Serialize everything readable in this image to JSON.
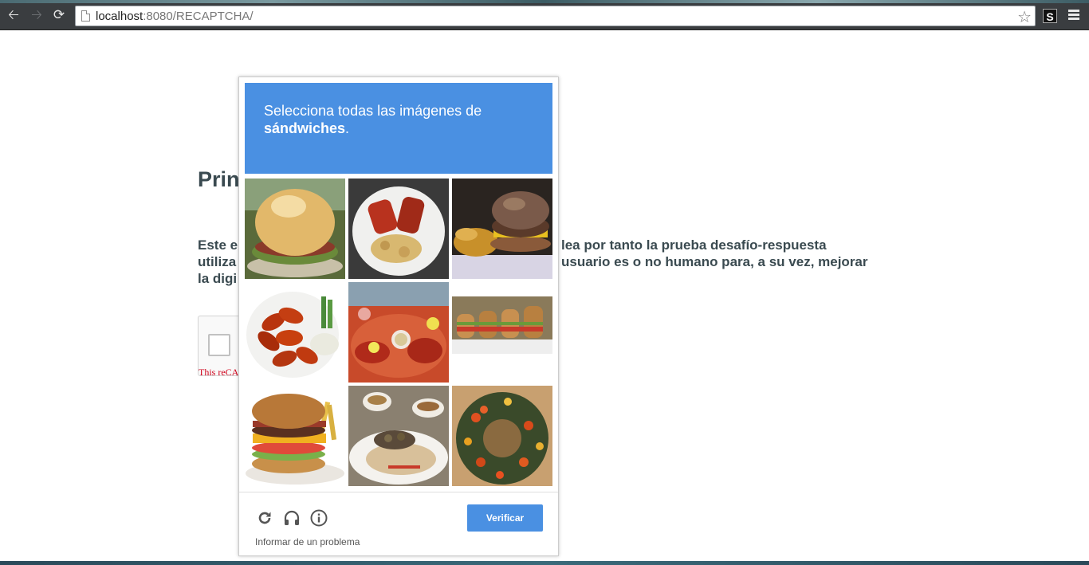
{
  "browser": {
    "url_host": "localhost",
    "url_rest": ":8080/RECAPTCHA/",
    "extension_label": "S",
    "icons": [
      "back-arrow-icon",
      "forward-arrow-icon",
      "reload-icon",
      "page-icon",
      "star-icon",
      "menu-icon"
    ]
  },
  "page": {
    "title_visible": "Prin",
    "paragraph_lines": [
      {
        "left": "Este e",
        "right": "lea por tanto la prueba desafío-respuesta"
      },
      {
        "left": "utiliza",
        "right": "usuario es o no humano para, a su vez, mejorar"
      },
      {
        "left": "la digi",
        "right": ""
      }
    ],
    "widget_error": "This reCA"
  },
  "challenge": {
    "instruction_line1": "Selecciona todas las imágenes de",
    "instruction_keyword": "sándwiches",
    "instruction_end": ".",
    "tiles": [
      "burger-bun-image",
      "ribs-plate-image",
      "burger-fries-image",
      "chicken-wings-image",
      "seafood-platter-image",
      "sliders-image",
      "bacon-cheeseburger-image",
      "rice-plate-image",
      "wreath-image"
    ],
    "verify_label": "Verificar",
    "report_label": "Informar de un problema",
    "footer_icons": [
      "reload-icon",
      "headphones-icon",
      "info-icon"
    ],
    "colors": {
      "header": "#4a90e2",
      "button": "#4a90e2"
    }
  }
}
